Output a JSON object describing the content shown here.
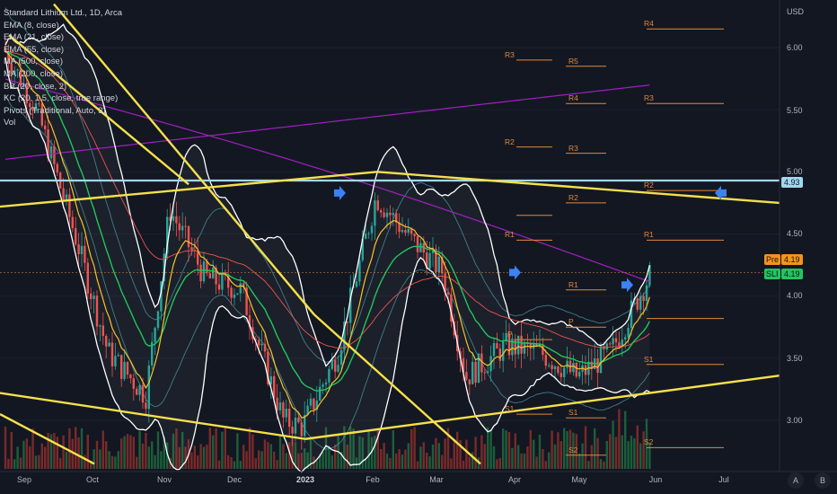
{
  "legend": {
    "symbol": "Standard Lithium Ltd., 1D, Arca",
    "indicators": [
      "EMA (8, close)",
      "EMA (21, close)",
      "EMA (55, close)",
      "MA (500, close)",
      "MA (200, close)",
      "BB (20, close, 2)",
      "KC (20, 1.5, close, true range)",
      "Pivots (Traditional, Auto, 3)",
      "Vol"
    ]
  },
  "axis": {
    "currency": "USD",
    "y_ticks": [
      "6.00",
      "5.50",
      "5.00",
      "4.50",
      "4.00",
      "3.50",
      "3.00"
    ],
    "x_ticks": [
      "Sep",
      "Oct",
      "Nov",
      "Dec",
      "2023",
      "Feb",
      "Mar",
      "Apr",
      "May",
      "Jun",
      "Jul"
    ]
  },
  "price_tags": {
    "level": "4.93",
    "pre_label": "Pre",
    "pre_value": "4.19",
    "sli_label": "SLI",
    "sli_value": "4.19"
  },
  "pivot_labels": [
    "R4",
    "R3",
    "R5",
    "R4",
    "R3",
    "R2",
    "R3",
    "R2",
    "R2",
    "R1",
    "R1",
    "R1",
    "P",
    "P",
    "S1",
    "S1",
    "S1",
    "S2",
    "S2"
  ],
  "buttons": {
    "auto": "A",
    "log": "B"
  },
  "colors": {
    "background": "#131722",
    "up": "#26a69a",
    "down": "#ef5350",
    "ema8": "#f7c32b",
    "ema21": "#22c55e",
    "ema55": "#ef5350",
    "ma500": "#a020c0",
    "bb": "#ffffff",
    "kc": "#4fa7b4",
    "trendline": "#f5e04b",
    "level_line": "#9fd8ef",
    "pivot": "#e0893b",
    "arrow": "#3b82f6"
  },
  "chart_data": {
    "type": "candlestick",
    "title": "Standard Lithium Ltd., 1D, Arca",
    "xlabel": "",
    "ylabel": "USD",
    "ylim": [
      2.65,
      6.35
    ],
    "horizontal_level": 4.93,
    "last_price": 4.19,
    "x_start": "2022-09-01",
    "x_end": "2023-07-31",
    "close_series": [
      {
        "date": "2022-09-01",
        "close": 6.0
      },
      {
        "date": "2022-09-15",
        "close": 5.5
      },
      {
        "date": "2022-10-01",
        "close": 4.5
      },
      {
        "date": "2022-10-15",
        "close": 3.55
      },
      {
        "date": "2022-10-31",
        "close": 3.2
      },
      {
        "date": "2022-11-10",
        "close": 4.7
      },
      {
        "date": "2022-11-25",
        "close": 4.15
      },
      {
        "date": "2022-12-10",
        "close": 4.05
      },
      {
        "date": "2022-12-28",
        "close": 3.0
      },
      {
        "date": "2023-01-05",
        "close": 2.95
      },
      {
        "date": "2023-01-20",
        "close": 3.55
      },
      {
        "date": "2023-02-05",
        "close": 4.8
      },
      {
        "date": "2023-02-20",
        "close": 4.45
      },
      {
        "date": "2023-03-05",
        "close": 4.2
      },
      {
        "date": "2023-03-15",
        "close": 3.35
      },
      {
        "date": "2023-04-01",
        "close": 3.6
      },
      {
        "date": "2023-04-15",
        "close": 3.55
      },
      {
        "date": "2023-05-01",
        "close": 3.35
      },
      {
        "date": "2023-05-15",
        "close": 3.55
      },
      {
        "date": "2023-06-01",
        "close": 4.19
      }
    ]
  }
}
